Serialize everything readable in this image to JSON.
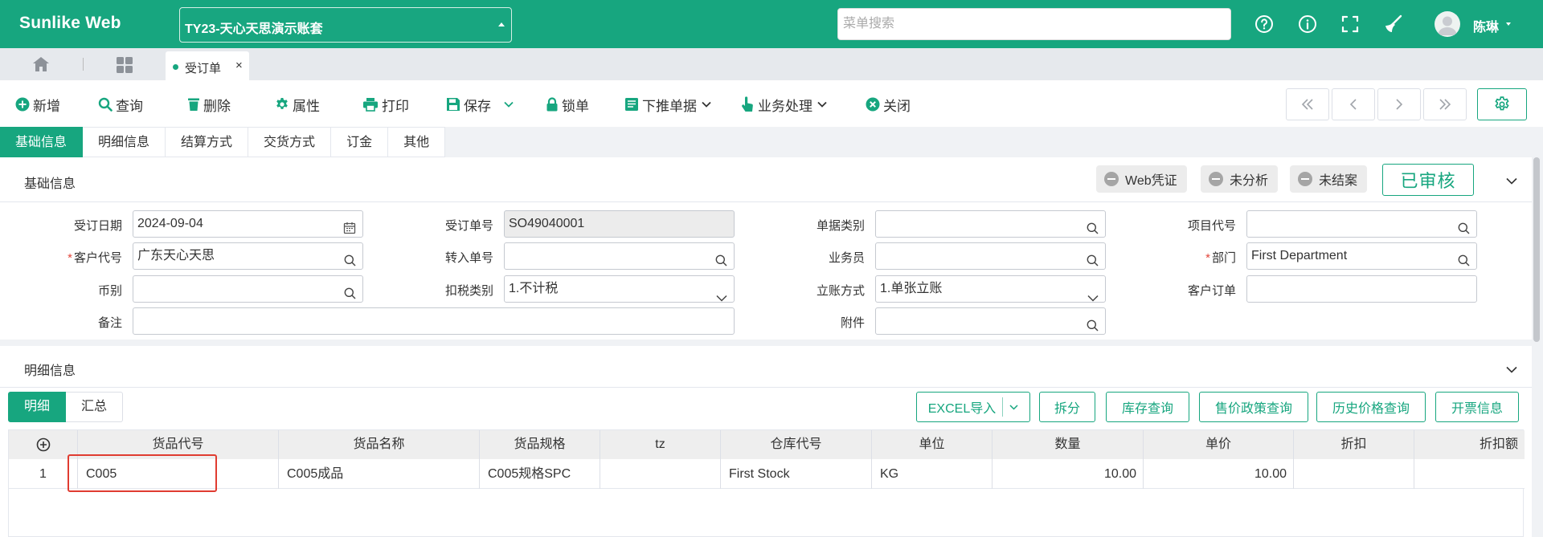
{
  "topbar": {
    "brand": "Sunlike Web",
    "account": "TY23-天心天思演示账套",
    "menu_search_placeholder": "菜单搜索",
    "user_name": "陈琳",
    "colors": {
      "primary": "#17a67f"
    }
  },
  "tabs": {
    "open_page": "受订单",
    "close_glyph": "×"
  },
  "toolbar": {
    "new": "新增",
    "query": "查询",
    "delete": "删除",
    "properties": "属性",
    "print": "打印",
    "save": "保存",
    "lock": "锁单",
    "push_down": "下推单据",
    "business": "业务处理",
    "close": "关闭"
  },
  "subtabs": [
    "基础信息",
    "明细信息",
    "结算方式",
    "交货方式",
    "订金",
    "其他"
  ],
  "basic": {
    "title": "基础信息",
    "tags": [
      "Web凭证",
      "未分析",
      "未结案"
    ],
    "approved": "已审核",
    "fields": {
      "order_date": {
        "label": "受订日期",
        "value": "2024-09-04"
      },
      "order_no": {
        "label": "受订单号",
        "value": "SO49040001"
      },
      "doc_type": {
        "label": "单据类别",
        "value": ""
      },
      "project_code": {
        "label": "项目代号",
        "value": ""
      },
      "customer_code": {
        "label": "客户代号",
        "value": "广东天心天思",
        "required": "*"
      },
      "transfer_no": {
        "label": "转入单号",
        "value": ""
      },
      "salesman": {
        "label": "业务员",
        "value": ""
      },
      "department": {
        "label": "部门",
        "value": "First Department",
        "required": "*"
      },
      "currency": {
        "label": "币别",
        "value": ""
      },
      "tax_type": {
        "label": "扣税类别",
        "value": "1.不计税"
      },
      "account_method": {
        "label": "立账方式",
        "value": "1.单张立账"
      },
      "customer_order": {
        "label": "客户订单",
        "value": ""
      },
      "remark": {
        "label": "备注",
        "value": ""
      },
      "attachment": {
        "label": "附件",
        "value": ""
      }
    }
  },
  "detail": {
    "title": "明细信息",
    "mini_tabs": [
      "明细",
      "汇总"
    ],
    "actions": {
      "excel_import": "EXCEL导入",
      "split": "拆分",
      "stock_query": "库存查询",
      "price_policy": "售价政策查询",
      "price_history": "历史价格查询",
      "invoice_info": "开票信息"
    },
    "columns": [
      "货品代号",
      "货品名称",
      "货品规格",
      "tz",
      "仓库代号",
      "单位",
      "数量",
      "单价",
      "折扣",
      "折扣额"
    ],
    "rows": [
      {
        "idx": "1",
        "code": "C005",
        "name": "C005成品",
        "spec": "C005规格SPC",
        "tz": "",
        "warehouse": "First Stock",
        "unit": "KG",
        "qty": "10.00",
        "price": "10.00",
        "discount": "",
        "discount_amt": ""
      }
    ]
  }
}
